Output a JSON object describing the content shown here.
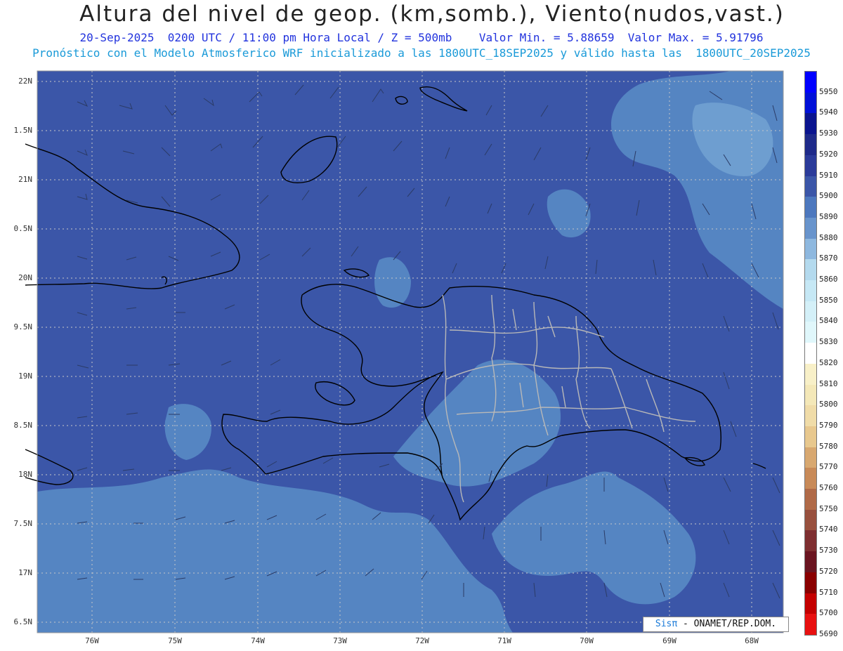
{
  "header": {
    "title": "Altura del nivel de geop. (km,somb.), Viento(nudos,vast.)",
    "subtitle1": "20-Sep-2025  0200 UTC / 11:00 pm Hora Local / Z = 500mb    Valor Min. = 5.88659  Valor Max. = 5.91796",
    "subtitle2": "Pronóstico con el Modelo Atmosferico WRF inicializado a las 1800UTC_18SEP2025 y válido hasta las  1800UTC_20SEP2025"
  },
  "map": {
    "lat_labels": [
      "22N",
      "1.5N",
      "21N",
      "0.5N",
      "20N",
      "9.5N",
      "19N",
      "8.5N",
      "18N",
      "7.5N",
      "17N",
      "6.5N"
    ],
    "lon_labels": [
      "76W",
      "75W",
      "74W",
      "73W",
      "72W",
      "71W",
      "70W",
      "69W",
      "68W"
    ],
    "colors": {
      "base": "#3b56a8",
      "lighter": "#5585c2",
      "lightest": "#6e9ed0",
      "coast": "#000000",
      "borders": "#b8b8b8",
      "barbs": "#2b3b66"
    }
  },
  "credit": {
    "brand": "Sisπ",
    "text": " - ONAMET/REP.DOM."
  },
  "colorbar": {
    "labels": [
      "5950",
      "5940",
      "5930",
      "5920",
      "5910",
      "5900",
      "5890",
      "5880",
      "5870",
      "5860",
      "5850",
      "5840",
      "5830",
      "5820",
      "5810",
      "5800",
      "5790",
      "5780",
      "5770",
      "5760",
      "5750",
      "5740",
      "5730",
      "5720",
      "5710",
      "5700",
      "5690"
    ],
    "colors": [
      "#0000ff",
      "#0010d8",
      "#0a148f",
      "#1e2a8a",
      "#2b3b9a",
      "#3b56a8",
      "#4d78be",
      "#6894cc",
      "#8eb8df",
      "#b4daee",
      "#c6e8f5",
      "#d4f0f8",
      "#e0f7fb",
      "#ffffff",
      "#f8f0c8",
      "#f4e8b8",
      "#f0dca8",
      "#e8c88e",
      "#d8a870",
      "#c88a58",
      "#b06a48",
      "#98503e",
      "#7e2e30",
      "#6a1420",
      "#8a0000",
      "#c40000",
      "#e81010"
    ]
  }
}
